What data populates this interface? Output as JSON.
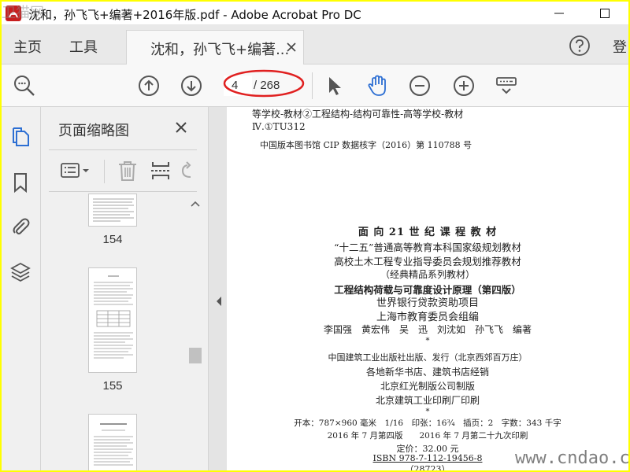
{
  "window": {
    "title": "沈和，孙飞飞+编著+2016年版.pdf - Adobe Acrobat Pro DC"
  },
  "tabbar": {
    "home": "主页",
    "tools": "工具",
    "doc_tab": "沈和，孙飞飞+编著...",
    "login": "登"
  },
  "toolbar": {
    "page_current": "4",
    "page_total": "/ 268"
  },
  "thumbnails": {
    "title": "页面缩略图",
    "pages": [
      {
        "label": "154"
      },
      {
        "label": "155"
      },
      {
        "label": ""
      }
    ]
  },
  "document": {
    "lines": {
      "l1": "等学校-教材②工程结构-结构可靠性-高等学校-教材",
      "l2": "Ⅳ.①TU312",
      "cip": "中国版本图书馆 CIP 数据核字（2016）第 110788 号",
      "series": "面 向 21 世 纪 课 程 教 材",
      "plan": "“十二五”普通高等教育本科国家级规划教材",
      "committee": "高校土木工程专业指导委员会规划推荐教材",
      "classic": "（经典精品系列教材）",
      "book_title": "工程结构荷载与可靠度设计原理（第四版）",
      "world_bank": "世界银行贷款资助项目",
      "shanghai": "上海市教育委员会组编",
      "authors": "李国强　黄宏伟　吴　迅　刘沈如　孙飞飞　编著",
      "star1": "*",
      "publisher": "中国建筑工业出版社出版、发行（北京西郊百万庄）",
      "sellers": "各地新华书店、建筑书店经销",
      "plate": "北京红光制版公司制版",
      "printer": "北京建筑工业印刷厂印刷",
      "star2": "*",
      "format": "开本：787×960 毫米　1/16　印张：16¾　插页：2　字数：343 千字",
      "edition": "2016 年 7 月第四版　　2016 年 7 月第二十九次印刷",
      "price": "定价：32.00 元",
      "isbn": "ISBN 978-7-112-19456-8",
      "code": "（28723）"
    }
  },
  "watermark": {
    "site": "www.cndao.com",
    "logo": "卫猫网"
  },
  "colors": {
    "border": "#ffff00",
    "accent_blue": "#2d6fd3",
    "annotation_red": "#e02020"
  }
}
